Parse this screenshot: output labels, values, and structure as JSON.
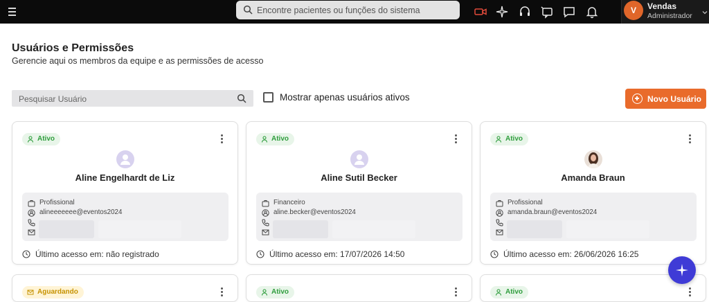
{
  "search": {
    "placeholder": "Encontre pacientes ou funções do sistema"
  },
  "user": {
    "initial": "V",
    "name": "Vendas",
    "role": "Administrador"
  },
  "header": {
    "title": "Usuários e Permissões",
    "subtitle": "Gerencie aqui os membros da equipe e as permissões de acesso"
  },
  "toolbar": {
    "user_search_placeholder": "Pesquisar Usuário",
    "active_only_label": "Mostrar apenas usuários ativos",
    "new_user_label": "Novo Usuário"
  },
  "colors": {
    "accent": "#e96b2b",
    "active_green": "#2e9d3c",
    "waiting_yellow": "#c69200",
    "fab": "#3f3bd6"
  },
  "cards": [
    {
      "status": "Ativo",
      "name": "Aline Engelhardt de Liz",
      "role": "Profissional",
      "login": "alineeeeeee@eventos2024",
      "last_access": "Último acesso em: não registrado"
    },
    {
      "status": "Ativo",
      "name": "Aline Sutil Becker",
      "role": "Financeiro",
      "login": "aline.becker@eventos2024",
      "last_access": "Último acesso em: 17/07/2026 14:50"
    },
    {
      "status": "Ativo",
      "name": "Amanda Braun",
      "role": "Profissional",
      "login": "amanda.braun@eventos2024",
      "last_access": "Último acesso em: 26/06/2026 16:25"
    },
    {
      "status": "Aguardando"
    },
    {
      "status": "Ativo"
    },
    {
      "status": "Ativo"
    }
  ]
}
